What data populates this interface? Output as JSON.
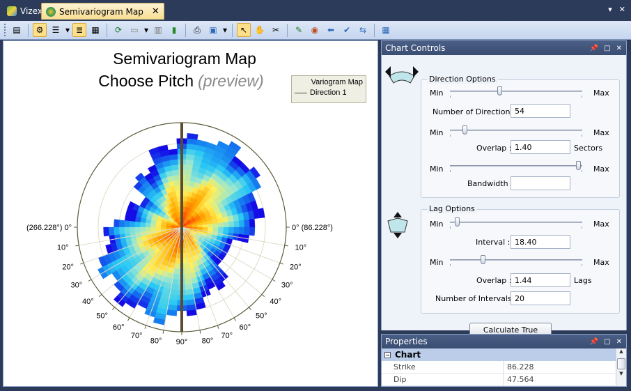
{
  "tabs": [
    {
      "label": "Vizex",
      "icon": "layers-icon"
    },
    {
      "label": "Semivariogram Map",
      "icon": "globe-icon"
    }
  ],
  "toolbar": {
    "tools": [
      "properties-icon",
      "settings-icon",
      "list-icon",
      "grid-icon",
      "refresh-icon",
      "printer-icon",
      "arrow-icon",
      "hand-icon",
      "tools-icon",
      "ruler-icon",
      "target-icon",
      "back-arrow-icon",
      "checkmark-icon",
      "swap-icon",
      "calendar-icon"
    ]
  },
  "chart": {
    "title": "Semivariogram Map",
    "subtitle": "Choose Pitch",
    "preview": "(preview)",
    "legend": {
      "title": "Variogram Map",
      "series": "Direction 1"
    },
    "left_label": "(266.228°) 0°",
    "right_label": "0° (86.228°)",
    "left_ticks": [
      "10°",
      "20°",
      "30°",
      "40°",
      "50°",
      "60°",
      "70°",
      "80°"
    ],
    "bottom_label": "90°",
    "right_ticks": [
      "80°",
      "70°",
      "60°",
      "50°",
      "40°",
      "30°",
      "20°",
      "10°"
    ]
  },
  "chart_data": {
    "type": "heatmap",
    "title": "Semivariogram Map",
    "subtitle": "Choose Pitch (preview)",
    "series": [
      {
        "name": "Direction 1"
      }
    ],
    "legend": [
      "Variogram Map",
      "Direction 1"
    ],
    "pitch_ticks_deg": [
      0,
      10,
      20,
      30,
      40,
      50,
      60,
      70,
      80,
      90
    ],
    "direction_line_deg": 90
  },
  "controls": {
    "title": "Chart Controls",
    "direction": {
      "title": "Direction Options",
      "min": "Min",
      "max": "Max",
      "num_directions_label": "Number of Directions :",
      "num_directions": "54",
      "num_slider": 0.37,
      "overlap_label": "Overlap :",
      "overlap": "1.40",
      "overlap_unit": "Sectors",
      "overlap_slider": 0.1,
      "bandwidth_label": "Bandwidth :",
      "bandwidth": "",
      "bandwidth_slider": 0.99
    },
    "lag": {
      "title": "Lag Options",
      "min": "Min",
      "max": "Max",
      "interval_label": "Interval :",
      "interval": "18.40",
      "interval_slider": 0.04,
      "overlap_label": "Overlap :",
      "overlap": "1.44",
      "overlap_unit": "Lags",
      "overlap_slider": 0.24,
      "num_intervals_label": "Number of Intervals :",
      "num_intervals": "20"
    },
    "calculate": "Calculate True"
  },
  "properties": {
    "title": "Properties",
    "category": "Chart",
    "rows": [
      {
        "key": "Strike",
        "value": "86.228"
      },
      {
        "key": "Dip",
        "value": "47.564"
      }
    ]
  }
}
